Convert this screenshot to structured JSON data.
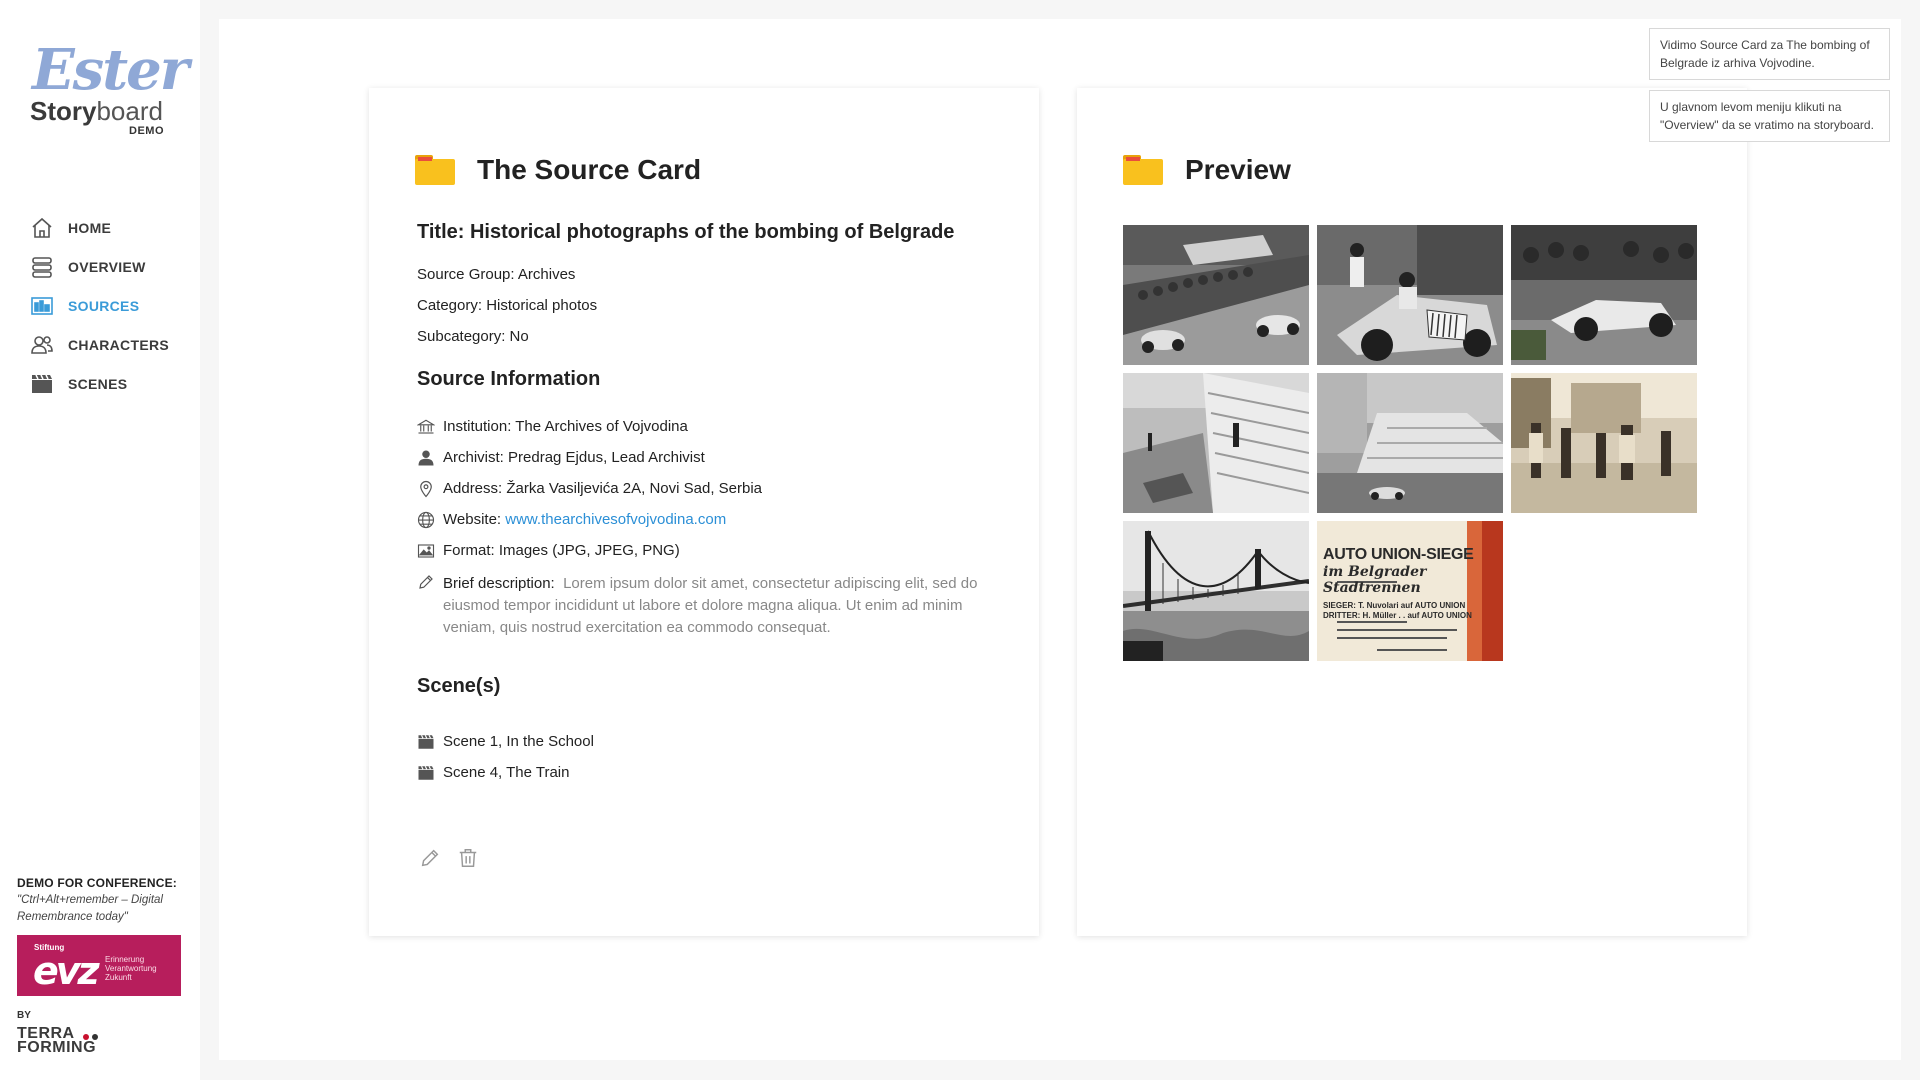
{
  "logo": {
    "name": "Ester",
    "product_bold": "Story",
    "product_light": "board",
    "badge": "DEMO"
  },
  "nav": [
    {
      "label": "HOME",
      "icon": "home-icon"
    },
    {
      "label": "OVERVIEW",
      "icon": "stack-icon"
    },
    {
      "label": "SOURCES",
      "icon": "sources-icon",
      "active": true
    },
    {
      "label": "CHARACTERS",
      "icon": "characters-icon"
    },
    {
      "label": "SCENES",
      "icon": "clapper-icon"
    }
  ],
  "conference": {
    "title": "DEMO FOR CONFERENCE:",
    "subtitle": "\"Ctrl+Alt+remember – Digital Remembrance today\"",
    "evz_top": "Stiftung",
    "evz_big": "evz",
    "evz_lines": [
      "Erinnerung",
      "Verantwortung",
      "Zukunft"
    ],
    "by": "BY",
    "terra_line1": "TERRA",
    "terra_line2": "FORMING"
  },
  "source_card": {
    "heading": "The Source Card",
    "title": "Title: Historical photographs of the bombing of Belgrade",
    "source_group": "Source Group: Archives",
    "category": "Category: Historical photos",
    "subcategory": "Subcategory: No",
    "info_heading": "Source Information",
    "institution": "Institution: The Archives of Vojvodina",
    "archivist": "Archivist: Predrag Ejdus, Lead Archivist",
    "address": "Address: Žarka Vasiljevića 2A, Novi Sad, Serbia",
    "website_label": "Website: ",
    "website_url": "www.thearchivesofvojvodina.com",
    "format": "Format: Images (JPG, JPEG, PNG)",
    "desc_label": "Brief description:",
    "desc_text": "Lorem ipsum dolor sit amet, consectetur adipiscing elit, sed do eiusmod tempor incididunt ut labore et dolore magna aliqua. Ut enim ad minim veniam, quis nostrud exercitation ea commodo consequat.",
    "scenes_heading": "Scene(s)",
    "scenes": [
      "Scene 1, In the School",
      "Scene 4, The Train"
    ]
  },
  "preview": {
    "heading": "Preview",
    "poster_line1": "AUTO UNION-SIEGE",
    "poster_line2": "im Belgrader Stadtrennen",
    "poster_line3": "SIEGER: T. Nuvolari auf AUTO UNION",
    "poster_line4": "DRITTER: H. Müller . . auf AUTO UNION"
  },
  "toasts": [
    "Vidimo Source Card za The bombing of Belgrade iz arhiva Vojvodine.",
    "U glavnom levom meniju klikuti na \"Overview\" da se vratimo na storyboard."
  ]
}
